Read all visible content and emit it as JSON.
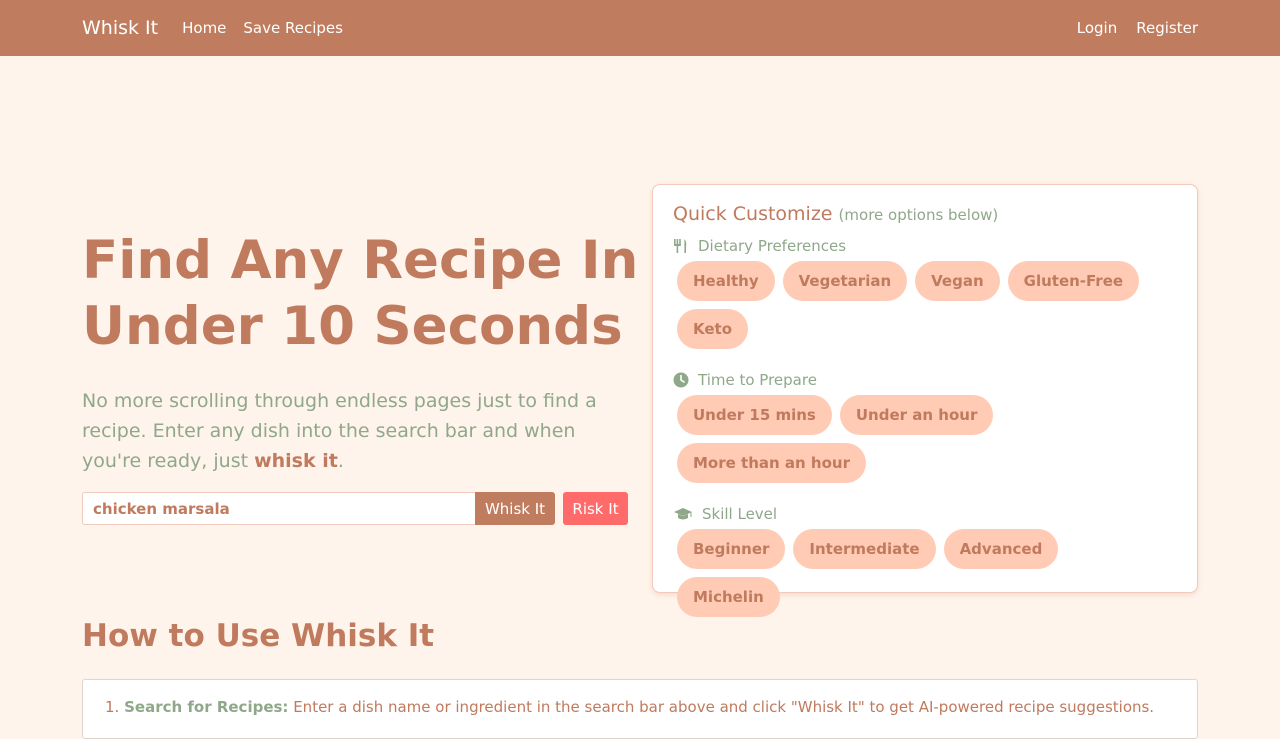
{
  "nav": {
    "brand": "Whisk It",
    "home": "Home",
    "save": "Save Recipes",
    "login": "Login",
    "register": "Register"
  },
  "hero": {
    "title_line1": "Find Any Recipe In",
    "title_line2": "Under 10 Seconds",
    "text_before": "No more scrolling through endless pages just to find a recipe. Enter any dish into the search bar and when you're ready, just ",
    "text_bold": "whisk it",
    "text_after": ".",
    "search_value": "chicken marsala",
    "whisk_label": "Whisk It",
    "risk_label": "Risk It"
  },
  "customize": {
    "title": "Quick Customize",
    "subtitle": "(more options below)",
    "dietary": {
      "label": "Dietary Preferences",
      "options": [
        "Healthy",
        "Vegetarian",
        "Vegan",
        "Gluten-Free",
        "Keto"
      ]
    },
    "time": {
      "label": "Time to Prepare",
      "options": [
        "Under 15 mins",
        "Under an hour",
        "More than an hour"
      ]
    },
    "skill": {
      "label": "Skill Level",
      "options": [
        "Beginner",
        "Intermediate",
        "Advanced",
        "Michelin"
      ]
    }
  },
  "howto": {
    "title": "How to Use Whisk It",
    "step1_num": "1.",
    "step1_bold": "Search for Recipes:",
    "step1_text": " Enter a dish name or ingredient in the search bar above and click \"Whisk It\" to get AI-powered recipe suggestions."
  },
  "icons": {
    "dietary": "utensils-icon",
    "time": "clock-icon",
    "skill": "graduation-cap-icon"
  },
  "colors": {
    "navbar": "#c07c5e",
    "background": "#fff4eb",
    "accent_green": "#8fa88a",
    "chip": "#ffcbb4",
    "risk": "#ff6b6b"
  }
}
